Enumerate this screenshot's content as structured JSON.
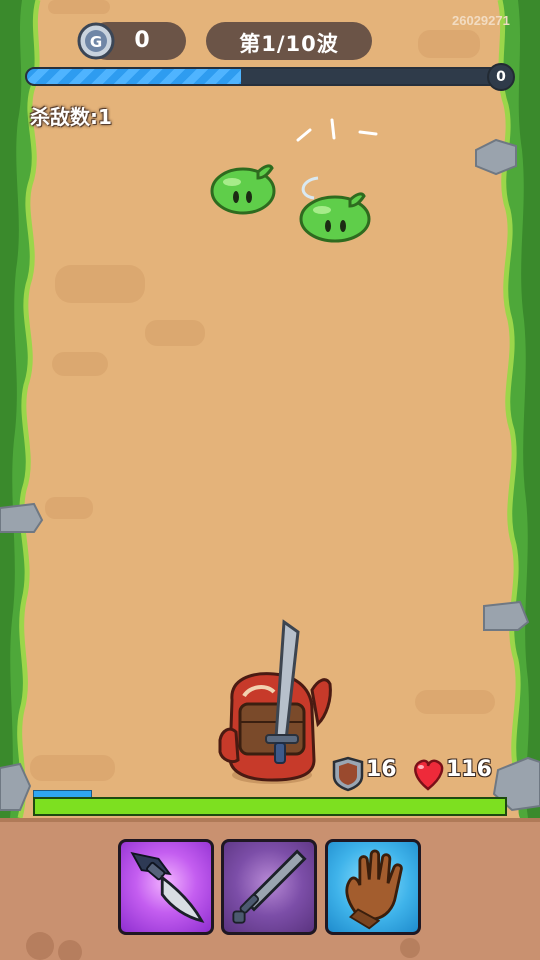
{
  "hud": {
    "coins": "0",
    "wave_label": "第1/10波",
    "build_id": "26029271",
    "wave_progress_end": "0",
    "wave_progress_fraction": 0.45
  },
  "kills": {
    "label": "杀敌数:1"
  },
  "player": {
    "defense": "16",
    "hp": "116",
    "hp_fraction": 1.0,
    "energy_fraction": 0.12
  },
  "skills": [
    {
      "name": "dagger-icon",
      "rarity_color": "#c45ef0"
    },
    {
      "name": "sword-icon",
      "rarity_color": "#7c4ea8"
    },
    {
      "name": "glove-icon",
      "rarity_color": "#3fb3ea"
    }
  ],
  "colors": {
    "road": "#e4b37a",
    "grass": "#4ea83a",
    "hp_bar": "#7de020",
    "progress": "#2e9cf0",
    "panel": "#c99170"
  }
}
